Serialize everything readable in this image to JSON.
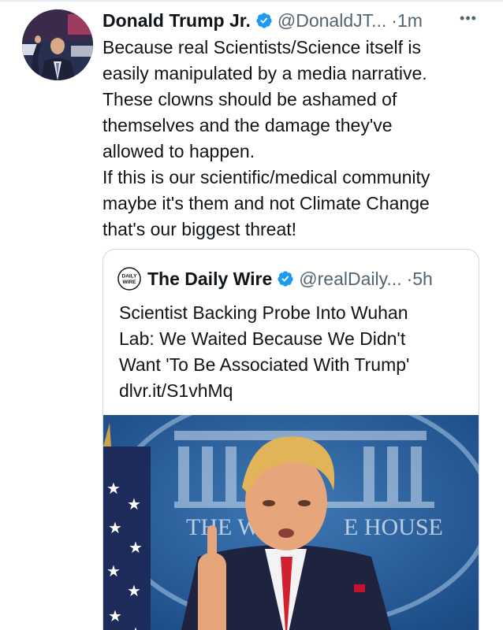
{
  "tweet": {
    "author_name": "Donald Trump Jr.",
    "handle": "@DonaldJT...",
    "time": "·1m",
    "more_icon": "more-horizontal-icon",
    "verified_icon": "verified-badge-icon",
    "text_lines": [
      "Because real Scientists/Science itself is",
      "easily manipulated by a media narrative.",
      "These clowns should be ashamed of",
      "themselves and the damage they've",
      "allowed to happen.",
      "If this is our scientific/medical community",
      "maybe it's them and not Climate Change",
      "that's our biggest threat!"
    ]
  },
  "quote": {
    "logo_text_top": "DAILY",
    "logo_text_bottom": "WIRE",
    "author_name": "The Daily Wire",
    "handle": "@realDaily...",
    "time": "·5h",
    "text_lines": [
      "Scientist Backing Probe Into Wuhan",
      "Lab: We Waited Because We Didn't",
      "Want 'To Be Associated With Trump'"
    ],
    "link": "dlvr.it/S1vhMq",
    "image_caption_left": "THE W",
    "image_caption_right": "E HOUSE"
  },
  "colors": {
    "verified_blue": "#1d9bf0",
    "secondary_text": "#536471",
    "border": "#cfd9de"
  }
}
